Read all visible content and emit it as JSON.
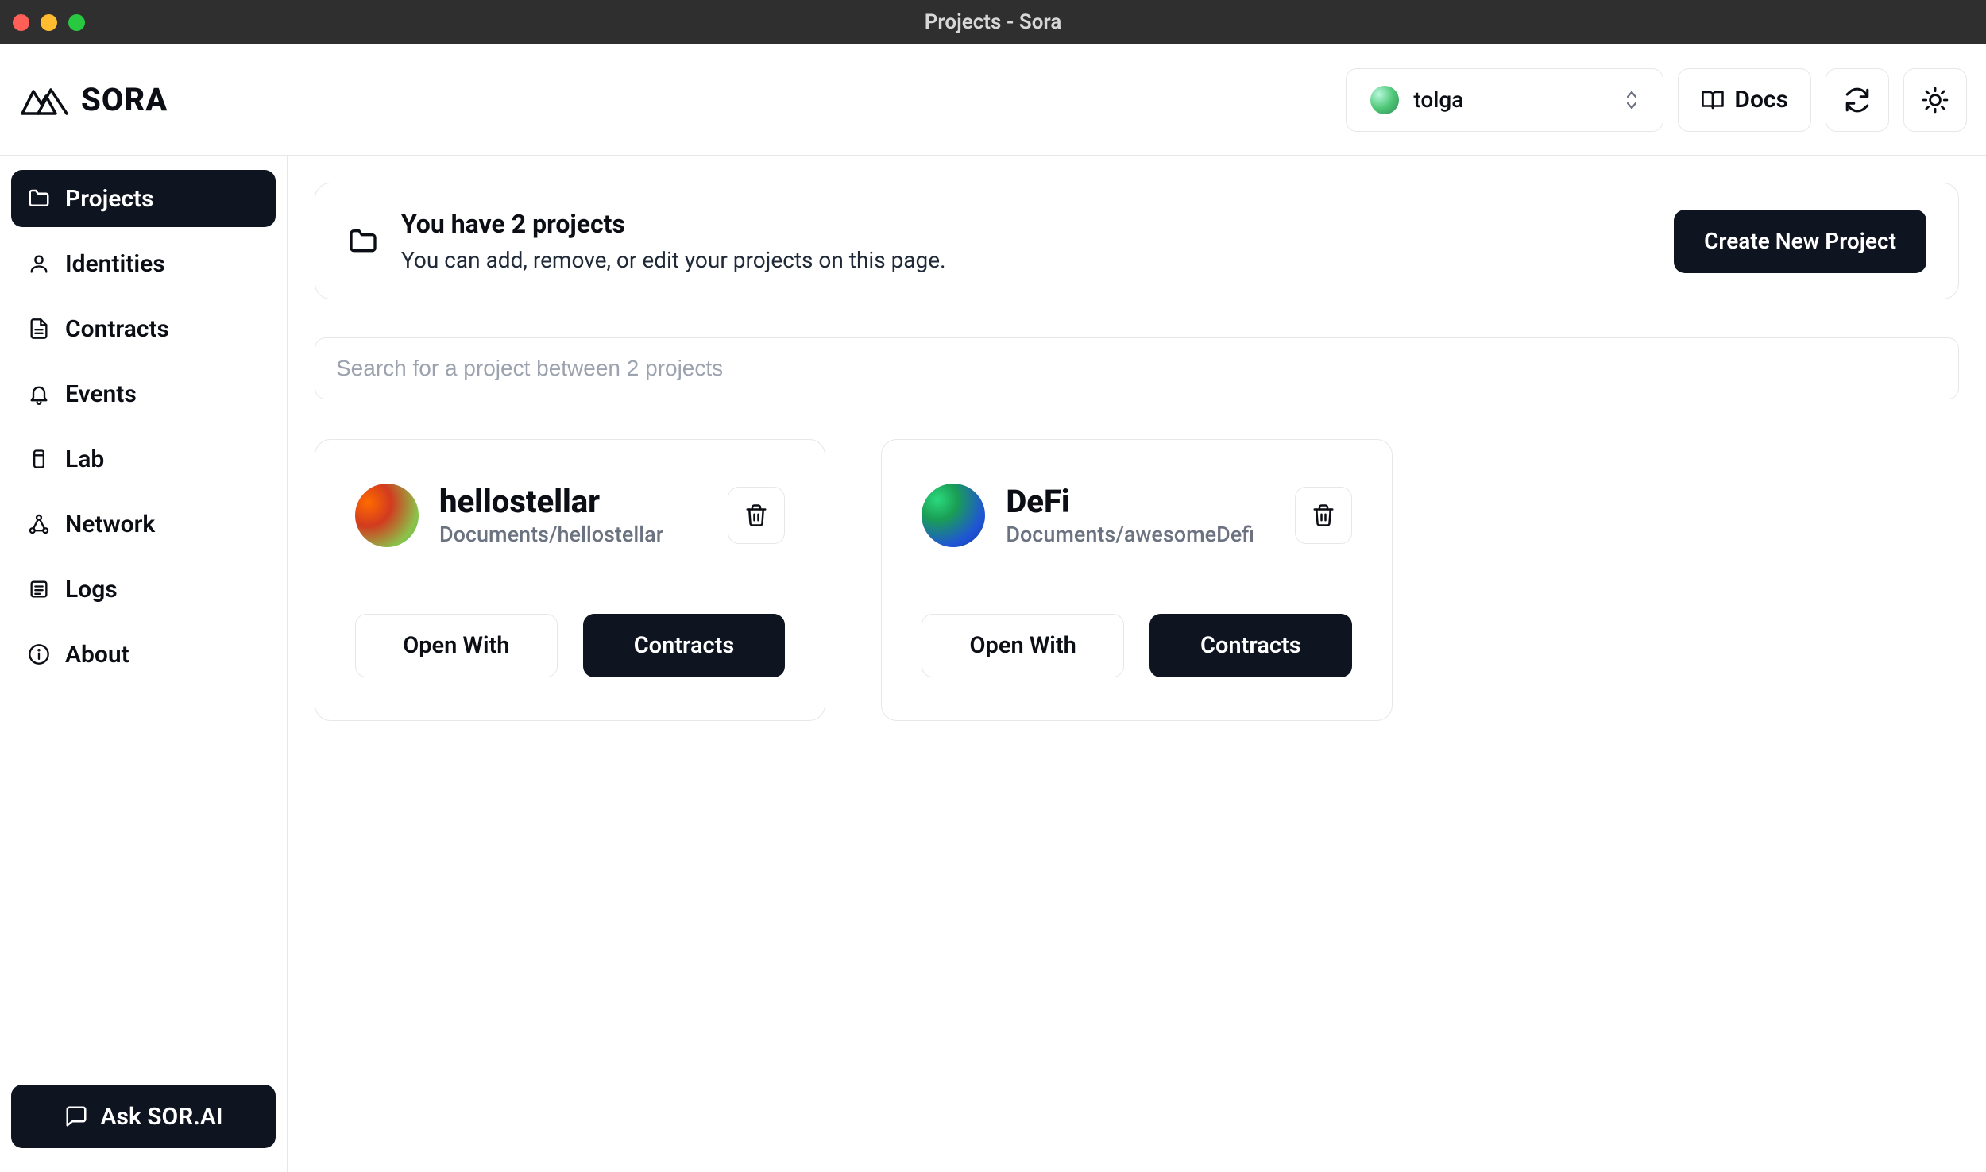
{
  "window": {
    "title": "Projects - Sora"
  },
  "brand": {
    "name": "SORA"
  },
  "header": {
    "account": "tolga",
    "docs_label": "Docs"
  },
  "sidebar": {
    "items": [
      {
        "label": "Projects"
      },
      {
        "label": "Identities"
      },
      {
        "label": "Contracts"
      },
      {
        "label": "Events"
      },
      {
        "label": "Lab"
      },
      {
        "label": "Network"
      },
      {
        "label": "Logs"
      },
      {
        "label": "About"
      }
    ],
    "ask_label": "Ask SOR.AI"
  },
  "banner": {
    "title": "You have 2 projects",
    "subtitle": "You can add, remove, or edit your projects on this page.",
    "create_label": "Create New Project"
  },
  "search": {
    "placeholder": "Search for a project between 2 projects"
  },
  "projects": [
    {
      "name": "hellostellar",
      "path": "Documents/hellostellar"
    },
    {
      "name": "DeFi",
      "path": "Documents/awesomeDefi"
    }
  ],
  "card_actions": {
    "open_with": "Open With",
    "contracts": "Contracts"
  }
}
